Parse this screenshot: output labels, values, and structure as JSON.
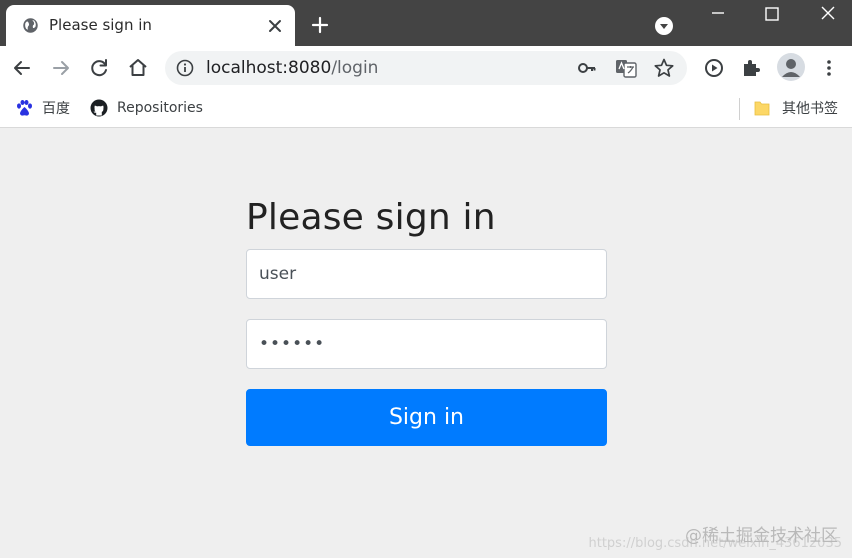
{
  "tab": {
    "title": "Please sign in"
  },
  "window": {
    "controls": [
      "minimize",
      "maximize",
      "close"
    ]
  },
  "omnibox": {
    "host": "localhost:8080",
    "path": "/login"
  },
  "bookmarks": [
    {
      "label": "百度",
      "icon": "baidu-paw-icon"
    },
    {
      "label": "Repositories",
      "icon": "github-icon"
    }
  ],
  "other_bookmarks": {
    "label": "其他书签",
    "icon": "folder-icon"
  },
  "page": {
    "heading": "Please sign in",
    "username_value": "user",
    "password_value": "••••••",
    "signin_label": "Sign in"
  },
  "watermark": {
    "text": "@稀土掘金技术社区",
    "sub": "https://blog.csdn.net/weixin_43612035"
  },
  "colors": {
    "tabstrip": "#444444",
    "primary_button": "#007bff",
    "page_bg": "#efefef"
  }
}
